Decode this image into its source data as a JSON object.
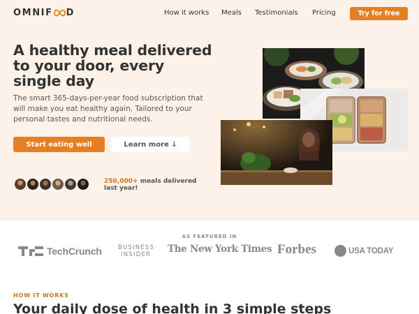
{
  "header": {
    "logo_text_left": "OMNIF",
    "logo_icon": "infinity-icon",
    "logo_text_right": "D",
    "nav": [
      "How it works",
      "Meals",
      "Testimonials",
      "Pricing"
    ],
    "cta": "Try for free"
  },
  "hero": {
    "headline": "A healthy meal delivered to your door, every single day",
    "description": "The smart 365-days-per-year food subscription that will make you eat healthy again. Tailored to your personal tastes and nutritional needs.",
    "primary_button": "Start eating well",
    "secondary_button": "Learn more ↓",
    "stat_number": "250,000+",
    "stat_text": "meals delivered last year!"
  },
  "featured": {
    "label": "AS FEATURED IN",
    "logos": {
      "techcrunch": "TechCrunch",
      "business_insider_1": "BUSINESS",
      "business_insider_2": "INSIDER",
      "nyt": "The New York Times",
      "forbes": "Forbes",
      "usatoday": "USA TODAY"
    }
  },
  "how_it_works": {
    "label": "HOW IT WORKS",
    "title": "Your daily dose of health in 3 simple steps"
  },
  "colors": {
    "accent": "#e67e22",
    "accent_dark": "#cf711f",
    "hero_bg": "#fdf2e9",
    "text": "#333333"
  }
}
